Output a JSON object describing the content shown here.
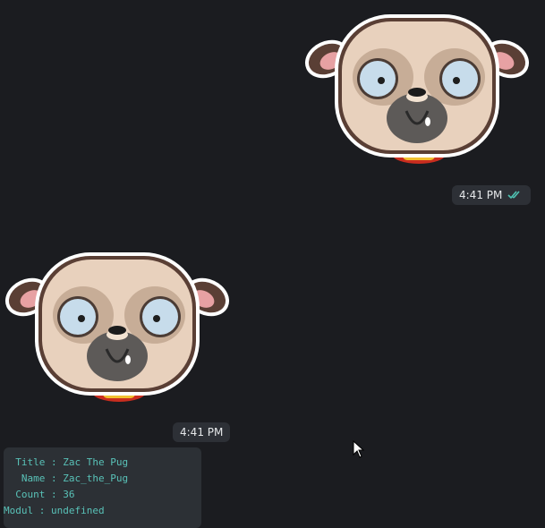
{
  "messages": [
    {
      "sticker_name": "pug-sticker",
      "time": "4:41 PM",
      "read_status": "double-check-icon"
    },
    {
      "sticker_name": "pug-sticker",
      "time": "4:41 PM"
    }
  ],
  "sticker_info": {
    "lines": [
      "  Title : Zac The Pug",
      "   Name : Zac_the_Pug",
      "  Count : 36",
      "Modul : undefined"
    ]
  },
  "colors": {
    "background": "#1b1c20",
    "pill": "#2d3036",
    "check": "#4fc3b3",
    "info_text": "#59c2b8"
  }
}
